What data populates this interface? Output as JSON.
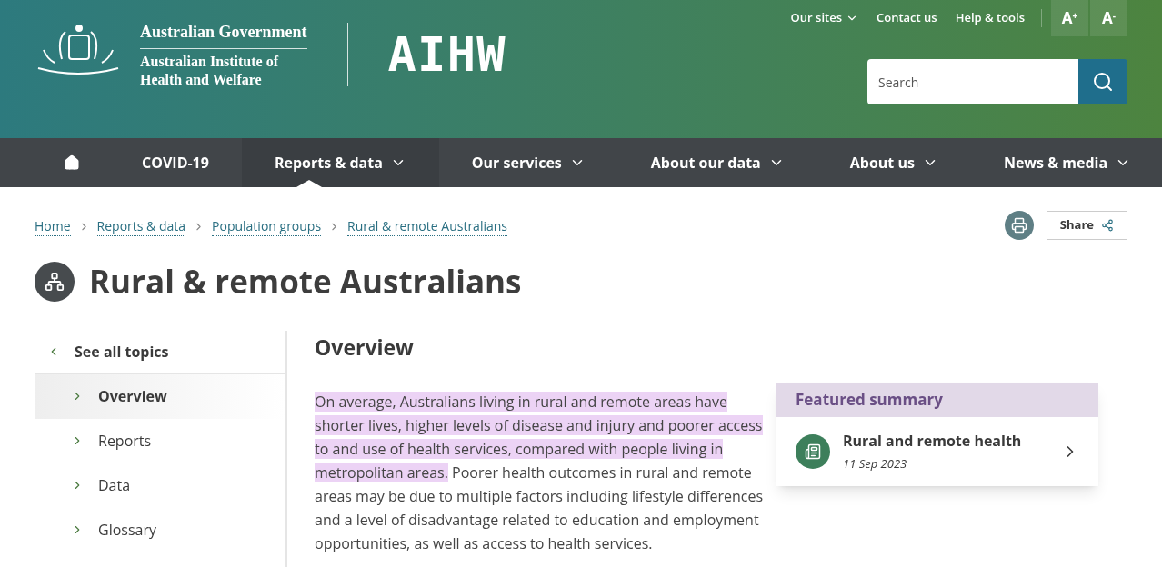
{
  "header": {
    "government": "Australian Government",
    "institute_line1": "Australian Institute of",
    "institute_line2": "Health and Welfare",
    "logo": "AIHW",
    "utility_links": [
      {
        "label": "Our sites",
        "dropdown": true
      },
      {
        "label": "Contact us",
        "dropdown": false
      },
      {
        "label": "Help & tools",
        "dropdown": false
      }
    ],
    "text_size": [
      {
        "label": "A",
        "sup": "+"
      },
      {
        "label": "A",
        "sup": "-"
      }
    ],
    "search": {
      "placeholder": "Search"
    }
  },
  "nav": [
    {
      "label": "COVID-19",
      "dropdown": false,
      "selected": false
    },
    {
      "label": "Reports & data",
      "dropdown": true,
      "selected": true
    },
    {
      "label": "Our services",
      "dropdown": true,
      "selected": false
    },
    {
      "label": "About our data",
      "dropdown": true,
      "selected": false
    },
    {
      "label": "About us",
      "dropdown": true,
      "selected": false
    },
    {
      "label": "News & media",
      "dropdown": true,
      "selected": false
    }
  ],
  "breadcrumbs": [
    "Home",
    "Reports & data",
    "Population groups",
    "Rural & remote Australians"
  ],
  "share": "Share",
  "title": "Rural & remote Australians",
  "sidebar": {
    "back": "See all topics",
    "items": [
      {
        "label": "Overview",
        "selected": true
      },
      {
        "label": "Reports",
        "selected": false
      },
      {
        "label": "Data",
        "selected": false
      },
      {
        "label": "Glossary",
        "selected": false
      }
    ]
  },
  "section_title": "Overview",
  "paragraph": {
    "highlighted": "On average, Australians living in rural and remote areas have shorter lives, higher levels of disease and injury and poorer access to and use of health services, compared with people living in metropolitan areas.",
    "rest": "Poorer health outcomes in rural and remote areas may be due to multiple factors including lifestyle differences and a level of disadvantage related to education and employment opportunities, as well as access to health services."
  },
  "featured": {
    "heading": "Featured summary",
    "title": "Rural and remote health",
    "date": "11 Sep 2023"
  }
}
